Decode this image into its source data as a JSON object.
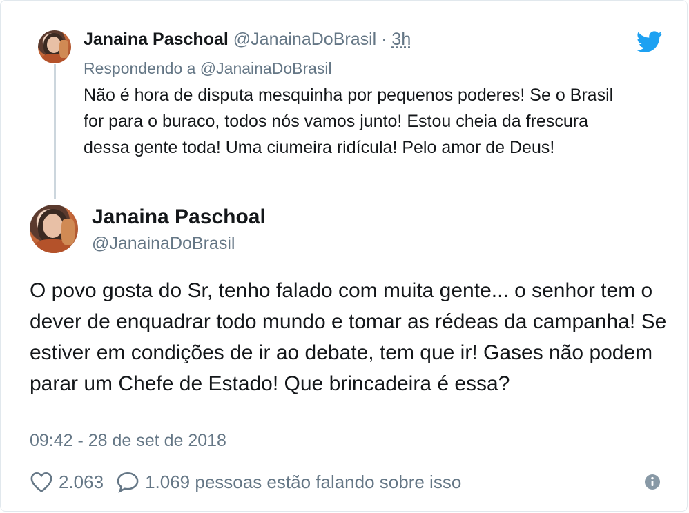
{
  "reply_tweet": {
    "name": "Janaina Paschoal",
    "handle": "@JanainaDoBrasil",
    "separator": " · ",
    "time": "3h",
    "replying_to": "Respondendo a @JanainaDoBrasil",
    "text": "Não é hora de disputa mesquinha por pequenos poderes! Se o Brasil for para o buraco, todos nós vamos junto! Estou cheia da frescura dessa gente toda! Uma ciumeira ridícula! Pelo amor de Deus!"
  },
  "main_tweet": {
    "name": "Janaina Paschoal",
    "handle": "@JanainaDoBrasil",
    "text": "O povo gosta do Sr, tenho falado com muita gente... o senhor tem o dever de enquadrar todo mundo e tomar as rédeas da campanha! Se estiver em condições de ir ao debate, tem que ir! Gases não podem parar um Chefe de Estado! Que brincadeira é essa?",
    "timestamp": "09:42 - 28 de set de 2018",
    "likes": "2.063",
    "conversation": "1.069 pessoas estão falando sobre isso"
  },
  "icons": {
    "brand": "twitter-bird-icon",
    "like": "heart-icon",
    "reply": "speech-bubble-icon",
    "info": "info-icon"
  },
  "colors": {
    "twitter_blue": "#1da1f2",
    "secondary_text": "#657786",
    "primary_text": "#14171a"
  }
}
